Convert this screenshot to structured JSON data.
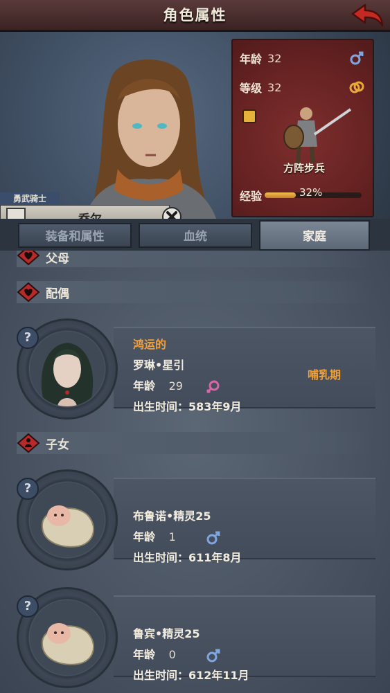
{
  "header": {
    "title": "角色属性"
  },
  "character": {
    "rank": "勇武骑士",
    "name": "乔尔"
  },
  "stats": {
    "age_label": "年龄",
    "age_value": "32",
    "level_label": "等级",
    "level_value": "32",
    "unit_name": "方阵步兵",
    "exp_label": "经验",
    "exp_percent": "32%",
    "exp_fraction": 0.32,
    "colors": {
      "panel": "#6d2626",
      "exp_bar": "#f2c052"
    }
  },
  "tabs": [
    {
      "label": "装备和属性"
    },
    {
      "label": "血统"
    },
    {
      "label": "家庭"
    }
  ],
  "family": {
    "parents_title": "父母",
    "spouse_title": "配偶",
    "children_title": "子女",
    "spouse": {
      "trait": "鸿运的",
      "name": "罗琳•星引",
      "age_label": "年龄",
      "age": "29",
      "birth": "出生时间：583年9月",
      "status": "哺乳期",
      "gender": "female-icon"
    },
    "children": [
      {
        "name": "布鲁诺•精灵25",
        "age_label": "年龄",
        "age": "1",
        "birth": "出生时间：611年8月",
        "gender": "male-icon"
      },
      {
        "name": "鲁宾•精灵25",
        "age_label": "年龄",
        "age": "0",
        "birth": "出生时间：612年11月",
        "gender": "male-icon"
      }
    ]
  }
}
